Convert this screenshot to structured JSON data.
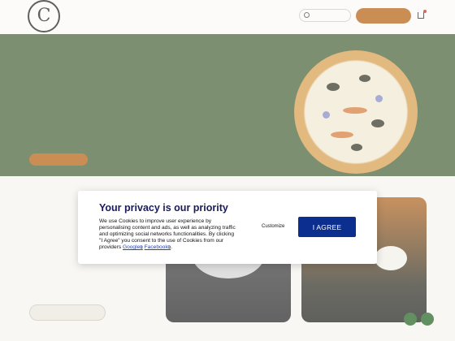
{
  "dialog": {
    "title": "Your privacy is our priority",
    "body_text": "We use Cookies to improve user experience by personalising content and ads, as well as analyzing traffic and optimizing social networks functionalities. By clicking \"I Agree\" you consent to the use of Cookies from our providers",
    "link_google": "Google",
    "link_separator": " ",
    "link_facebook": "Facebook",
    "ext_icon": "⧉",
    "period": ".",
    "customize_label": "Customize",
    "agree_label": "I AGREE"
  },
  "colors": {
    "dialog_title": "#1a1a5e",
    "agree_button": "#0c2f8f",
    "link": "#1f3fc0",
    "hero_bg": "#506a40",
    "accent_orange": "#b9691c"
  }
}
